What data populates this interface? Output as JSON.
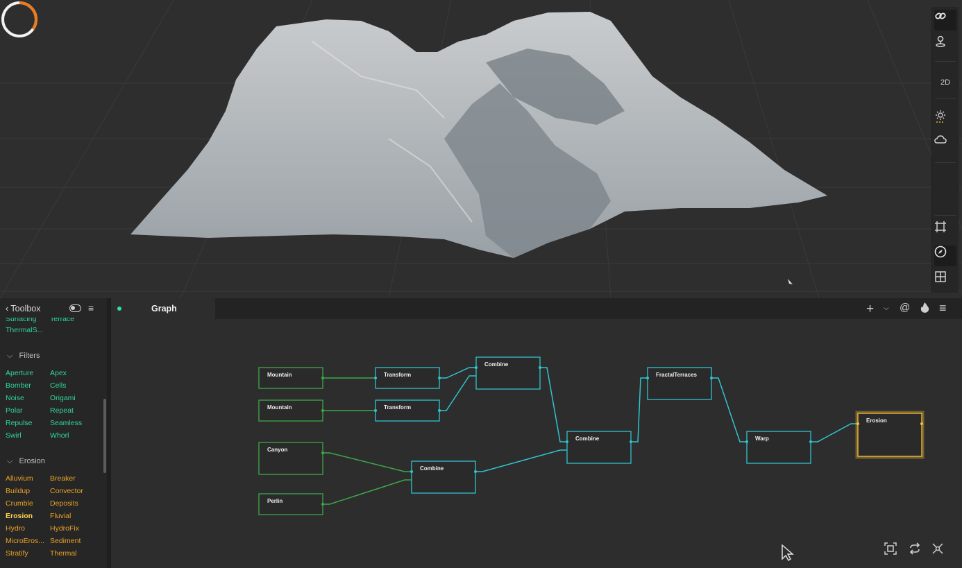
{
  "viewport": {
    "view_mode_label": "2D",
    "progress": 0.35,
    "colors": {
      "terrain": "#b7bcc0",
      "progress_accent": "#f07a1a"
    },
    "toolbar_icons": [
      "link-icon",
      "pin-icon",
      "2d-toggle",
      "sun-icon",
      "cloud-icon",
      "frame-icon",
      "compass-icon",
      "grid-icon"
    ]
  },
  "toolbox": {
    "title": "Toolbox",
    "partial_top": [
      "Surfacing",
      "Terrace"
    ],
    "partial_top_2": [
      "ThermalS..."
    ],
    "filters_title": "Filters",
    "filters": [
      "Aperture",
      "Apex",
      "Bomber",
      "Cells",
      "Noise",
      "Origami",
      "Polar",
      "Repeat",
      "Repulse",
      "Seamless",
      "Swirl",
      "Whorl"
    ],
    "erosion_title": "Erosion",
    "erosion": [
      "Alluvium",
      "Breaker",
      "Buildup",
      "Convector",
      "Crumble",
      "Deposits",
      "Erosion",
      "Fluvial",
      "Hydro",
      "HydroFix",
      "MicroEros...",
      "Sediment",
      "Stratify",
      "Thermal"
    ],
    "selected": "Erosion",
    "colors": {
      "filter": "#2fd79a",
      "erosion": "#e9a126",
      "selected": "#ffd54a"
    }
  },
  "graph": {
    "tab_label": "Graph",
    "nodes": {
      "mountain1": "Mountain",
      "mountain2": "Mountain",
      "canyon": "Canyon",
      "perlin": "Perlin",
      "transform1": "Transform",
      "transform2": "Transform",
      "combine1": "Combine",
      "combine2": "Combine",
      "combine3": "Combine",
      "fractal": "FractalTerraces",
      "warp": "Warp",
      "erosion": "Erosion"
    },
    "colors": {
      "primitive": "#3fa84a",
      "adjust": "#2fc4cf",
      "erosion_node": "#f5c03a"
    }
  }
}
